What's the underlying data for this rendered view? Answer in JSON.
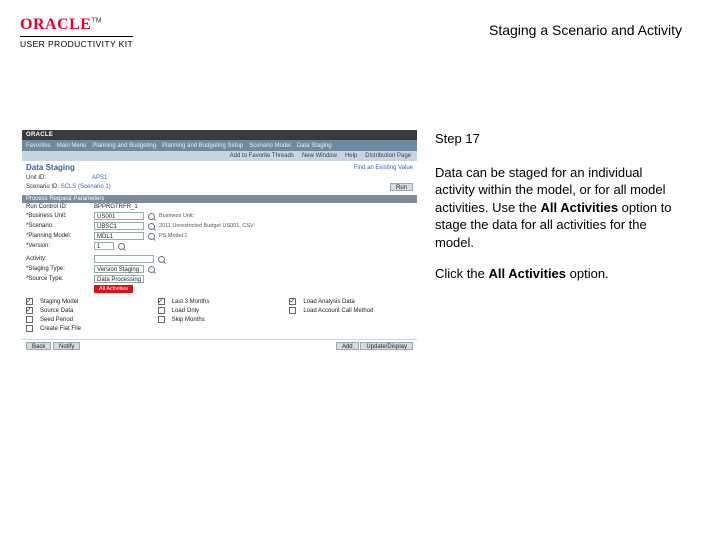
{
  "header": {
    "brand": "ORACLE",
    "brand_sub": "USER PRODUCTIVITY KIT",
    "tm": "TM",
    "doc_title": "Staging a Scenario and Activity"
  },
  "instructions": {
    "step_label": "Step 17",
    "body_pre": "Data can be staged for an individual activity within the model, or for all model activities. Use the ",
    "body_bold1": "All Activities",
    "body_mid": " option to stage the data for all activities for the model.",
    "action_pre": "Click the ",
    "action_bold": "All Activities",
    "action_post": " option."
  },
  "mock": {
    "oracle_word": "ORACLE",
    "nav": [
      "Favorites",
      "Main Menu",
      "Planning and Budgeting",
      "Planning and Budgeting Setup",
      "Scenario Model",
      "Data Staging"
    ],
    "sublinks": [
      "Add to Favorite Threads",
      "New Window",
      "Help",
      "Distribution Page"
    ],
    "page_title": "Data Staging",
    "run_link": "Find an Existing Value",
    "unitid_label": "Unit ID:",
    "unitid_val": "APS1",
    "subtitle_label": "Scenario ID:",
    "subtitle_val": "SCLS (Scenario 1)",
    "run_btn": "Run",
    "band": "Process Request Parameters",
    "rows": {
      "run_control": {
        "label": "Run Control ID:",
        "value": "BPPRGTRFR_1"
      },
      "bu": {
        "label": "*Business Unit:",
        "value": "US001",
        "hint": "Business Unit:"
      },
      "scenario": {
        "label": "*Scenario:",
        "value": "UBSC1",
        "desc": "2011 Unrestricted Budget US001, CSV:"
      },
      "model": {
        "label": "*Planning Model:",
        "value": "MDL1",
        "desc": "PS Model 1"
      },
      "version": {
        "label": "*Version:",
        "value": "1"
      }
    },
    "activity_label": "Activity:",
    "staging_type_label": "*Staging Type:",
    "staging_type_value": "Version Staging",
    "source_type_label": "*Source Type:",
    "source_type_value": "Data Processing",
    "all_activities_link": "All Activities",
    "check_cols": [
      [
        "Staging Model",
        "Source Data",
        "Seed Period",
        "Create Flat File"
      ],
      [
        "Last 3 Months",
        "Load Only",
        "Skip Months"
      ],
      [
        "Load Analysis Data",
        "Load Account Call Method"
      ]
    ],
    "footer": {
      "left": [
        "Back",
        "Notify"
      ],
      "right": [
        "Add",
        "Update/Display"
      ]
    }
  }
}
